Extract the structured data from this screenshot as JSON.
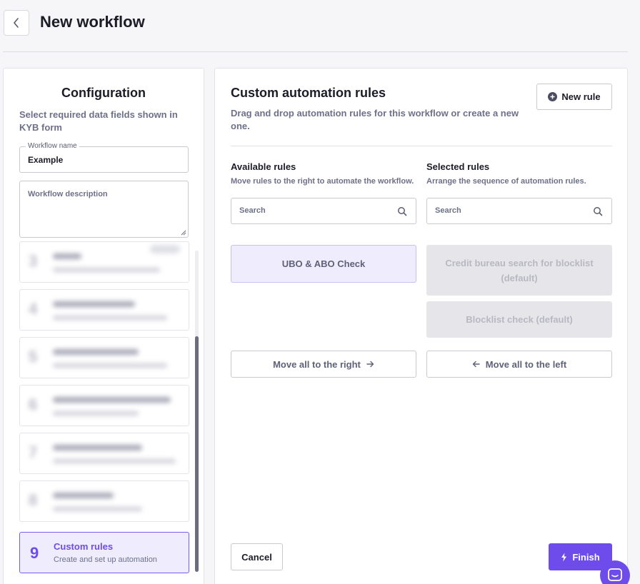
{
  "header": {
    "title": "New workflow",
    "back_icon": "chevron-left-icon"
  },
  "config": {
    "title": "Configuration",
    "subtitle": "Select required data fields shown in KYB form",
    "workflow_name": {
      "label": "Workflow name",
      "value": "Example"
    },
    "workflow_description": {
      "placeholder": "Workflow description"
    },
    "active_step": {
      "number": "9",
      "title": "Custom rules",
      "description": "Create and set up automation"
    }
  },
  "rules": {
    "title": "Custom automation rules",
    "subtitle": "Drag and drop automation rules for this workflow or create a new one.",
    "new_rule_label": "New rule",
    "available": {
      "title": "Available rules",
      "subtitle": "Move rules to the right to automate the workflow.",
      "search_placeholder": "Search",
      "items": [
        "UBO & ABO Check"
      ],
      "move_all_label": "Move all to the right"
    },
    "selected": {
      "title": "Selected rules",
      "subtitle": "Arrange the sequence of automation rules.",
      "search_placeholder": "Search",
      "items": [
        "Credit bureau search for blocklist (default)",
        "Blocklist check (default)"
      ],
      "move_all_label": "Move all to the left"
    }
  },
  "footer": {
    "cancel_label": "Cancel",
    "finish_label": "Finish"
  },
  "colors": {
    "accent": "#6d4ceb",
    "accent_light": "#efecfe",
    "muted_text": "#6e7089",
    "disabled_card": "#e6e6ea"
  }
}
